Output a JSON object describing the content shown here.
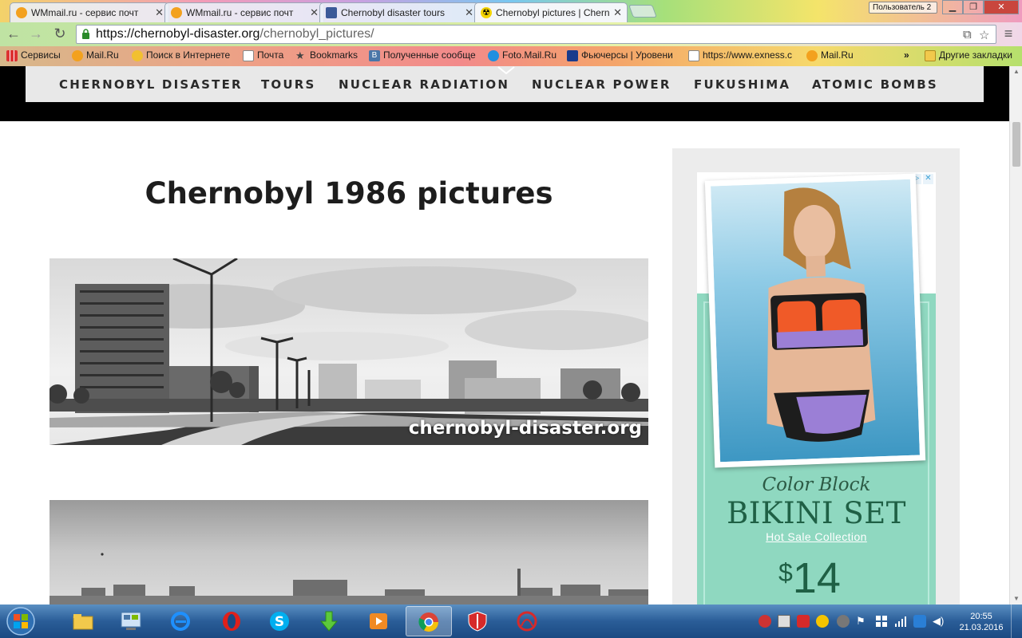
{
  "browser": {
    "tabs": [
      {
        "title": "WMmail.ru - сервис почт",
        "active": false
      },
      {
        "title": "WMmail.ru - сервис почт",
        "active": false
      },
      {
        "title": "Chernobyl disaster tours",
        "active": false
      },
      {
        "title": "Chernobyl pictures | Chern",
        "active": true
      }
    ],
    "user_label": "Пользователь 2",
    "url_host": "https://chernobyl-disaster.org",
    "url_path": "/chernobyl_pictures/",
    "bookmarks": [
      "Сервисы",
      "Mail.Ru",
      "Поиск в Интернете",
      "Почта",
      "Bookmarks",
      "Полученные сообще",
      "Foto.Mail.Ru",
      "Фьючерсы | Уровени",
      "https://www.exness.c",
      "Mail.Ru"
    ],
    "bookmarks_overflow": "»",
    "other_bookmarks": "Другие закладки"
  },
  "site": {
    "nav": [
      "CHERNOBYL DISASTER",
      "TOURS",
      "NUCLEAR RADIATION",
      "NUCLEAR POWER",
      "FUKUSHIMA",
      "ATOMIC BOMBS"
    ],
    "page_title": "Chernobyl 1986 pictures",
    "watermark": "chernobyl-disaster.org"
  },
  "ad": {
    "line1": "Color Block",
    "line2": "BIKINI SET",
    "line3": "Hot Sale Collection",
    "currency": "$",
    "price": "14",
    "accent": "#8fd8c0"
  },
  "taskbar": {
    "apps": [
      "explorer-icon",
      "control-panel-icon",
      "internet-explorer-icon",
      "opera-icon",
      "skype-icon",
      "download-icon",
      "media-player-icon",
      "chrome-icon",
      "shield-icon",
      "app-icon"
    ],
    "active_app": "chrome-icon",
    "time": "20:55",
    "date": "21.03.2016"
  }
}
